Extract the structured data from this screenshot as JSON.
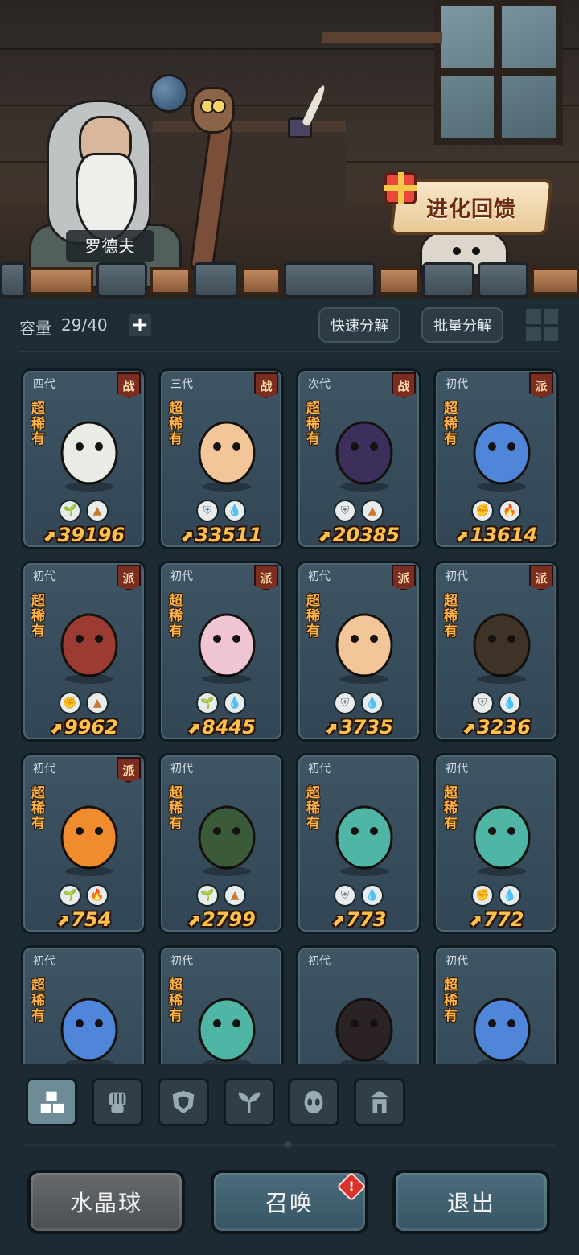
{
  "scene": {
    "npc_name": "罗德夫",
    "evolve_banner": "进化回馈"
  },
  "capacity": {
    "label": "容量",
    "value": "29/40",
    "add_icon": "plus-icon"
  },
  "toolbar": {
    "quick_decompose": "快速分解",
    "batch_decompose": "批量分解",
    "view_toggle_icon": "grid-view-icon"
  },
  "pets": [
    {
      "gen": "四代",
      "role": "战",
      "rarity": "超稀有",
      "power": "39196",
      "badges": [
        "leaf-icon",
        "earth-icon"
      ],
      "color": "#e9ece5"
    },
    {
      "gen": "三代",
      "role": "战",
      "rarity": "超稀有",
      "power": "33511",
      "badges": [
        "shield-icon",
        "water-icon"
      ],
      "color": "#f3c69a"
    },
    {
      "gen": "次代",
      "role": "战",
      "rarity": "超稀有",
      "power": "20385",
      "badges": [
        "shield-icon",
        "earth-icon"
      ],
      "color": "#3c2f5c"
    },
    {
      "gen": "初代",
      "role": "派",
      "rarity": "超稀有",
      "power": "13614",
      "badges": [
        "fist-icon",
        "fire-icon"
      ],
      "color": "#4f86d9"
    },
    {
      "gen": "初代",
      "role": "派",
      "rarity": "超稀有",
      "power": "9962",
      "badges": [
        "fist-icon",
        "earth-icon"
      ],
      "color": "#9b3b31"
    },
    {
      "gen": "初代",
      "role": "派",
      "rarity": "超稀有",
      "power": "8445",
      "badges": [
        "leaf-icon",
        "water-icon"
      ],
      "color": "#f0c5d3"
    },
    {
      "gen": "初代",
      "role": "派",
      "rarity": "超稀有",
      "power": "3735",
      "badges": [
        "shield-icon",
        "water-icon"
      ],
      "color": "#f3c69a"
    },
    {
      "gen": "初代",
      "role": "派",
      "rarity": "超稀有",
      "power": "3236",
      "badges": [
        "shield-icon",
        "water-icon"
      ],
      "color": "#3f3328"
    },
    {
      "gen": "初代",
      "role": "派",
      "rarity": "超稀有",
      "power": "754",
      "badges": [
        "leaf-icon",
        "fire-icon"
      ],
      "color": "#f08b2e"
    },
    {
      "gen": "初代",
      "role": "",
      "rarity": "超稀有",
      "power": "2799",
      "badges": [
        "leaf-icon",
        "earth-icon"
      ],
      "color": "#3b5a3a"
    },
    {
      "gen": "初代",
      "role": "",
      "rarity": "超稀有",
      "power": "773",
      "badges": [
        "shield-icon",
        "water-icon"
      ],
      "color": "#4fb6a6"
    },
    {
      "gen": "初代",
      "role": "",
      "rarity": "超稀有",
      "power": "772",
      "badges": [
        "fist-icon",
        "water-icon"
      ],
      "color": "#4fb6a6"
    },
    {
      "gen": "初代",
      "role": "",
      "rarity": "超稀有",
      "power": "",
      "badges": [],
      "color": "#4f86d9"
    },
    {
      "gen": "初代",
      "role": "",
      "rarity": "超稀有",
      "power": "",
      "badges": [],
      "color": "#4fb6a6"
    },
    {
      "gen": "初代",
      "role": "",
      "rarity": "",
      "power": "",
      "badges": [],
      "color": "#2b2226"
    },
    {
      "gen": "初代",
      "role": "",
      "rarity": "超稀有",
      "power": "",
      "badges": [],
      "color": "#4f86d9"
    }
  ],
  "filters": [
    {
      "icon": "all-blocks-icon",
      "active": true
    },
    {
      "icon": "fist-icon",
      "active": false
    },
    {
      "icon": "shield-icon",
      "active": false
    },
    {
      "icon": "leaf-icon",
      "active": false
    },
    {
      "icon": "alien-head-icon",
      "active": false
    },
    {
      "icon": "tower-icon",
      "active": false
    }
  ],
  "buttons": {
    "crystal_ball": "水晶球",
    "summon": "召唤",
    "summon_alert": "!",
    "exit": "退出"
  },
  "colors": {
    "background": "#1b2a33",
    "card": "#3e5563",
    "power_text": "#ffc14a",
    "rarity_text": "#ffb347",
    "role_badge": "#7a2e22"
  }
}
